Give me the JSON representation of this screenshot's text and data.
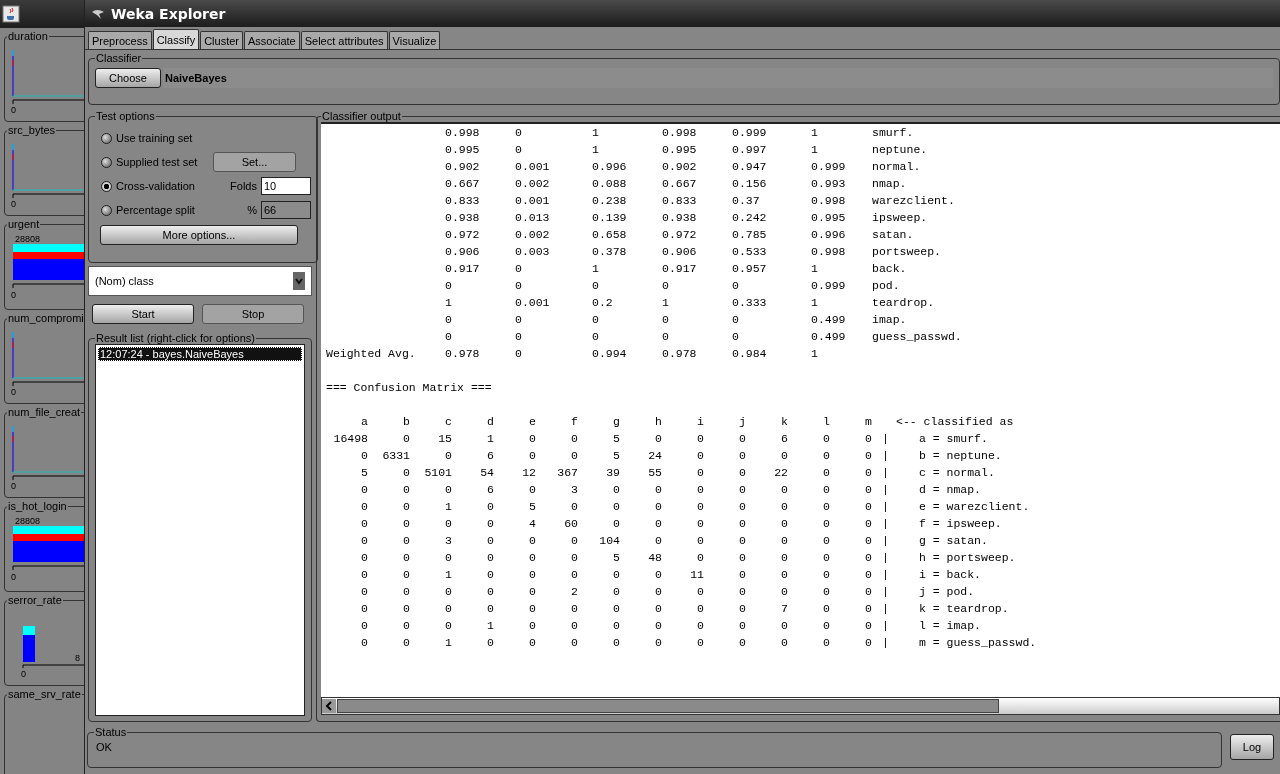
{
  "window": {
    "title": "Weka Explorer"
  },
  "attribute_panels": [
    {
      "name": "duration",
      "kind": "spike",
      "axis_label": "0"
    },
    {
      "name": "src_bytes",
      "kind": "spike",
      "axis_label": "0"
    },
    {
      "name": "urgent",
      "kind": "stacked",
      "count_label": "28808",
      "axis_label": "0"
    },
    {
      "name": "num_compromi",
      "kind": "spike",
      "axis_label": "0"
    },
    {
      "name": "num_file_creat",
      "kind": "spike",
      "axis_label": "0"
    },
    {
      "name": "is_hot_login",
      "kind": "stacked",
      "count_label": "28808",
      "axis_label": "0"
    },
    {
      "name": "serror_rate",
      "kind": "column",
      "count_label": "8",
      "axis_label": "0"
    },
    {
      "name": "same_srv_rate",
      "kind": "empty"
    }
  ],
  "tabs": [
    {
      "label": "Preprocess",
      "selected": false
    },
    {
      "label": "Classify",
      "selected": true
    },
    {
      "label": "Cluster",
      "selected": false
    },
    {
      "label": "Associate",
      "selected": false
    },
    {
      "label": "Select attributes",
      "selected": false
    },
    {
      "label": "Visualize",
      "selected": false
    }
  ],
  "classifier": {
    "title": "Classifier",
    "button": "Choose",
    "name": "NaiveBayes"
  },
  "test_options": {
    "title": "Test options",
    "options": [
      {
        "label": "Use training set",
        "selected": false
      },
      {
        "label": "Supplied test set",
        "selected": false
      },
      {
        "label": "Cross-validation",
        "selected": true
      },
      {
        "label": "Percentage split",
        "selected": false
      }
    ],
    "set_button": {
      "label": "Set...",
      "disabled": true
    },
    "folds": {
      "label": "Folds",
      "value": "10",
      "disabled": false
    },
    "percent": {
      "label": "%",
      "value": "66",
      "disabled": true
    },
    "more_button": "More options..."
  },
  "class_selector": {
    "value": "(Nom) class"
  },
  "start_button": {
    "label": "Start",
    "disabled": false
  },
  "stop_button": {
    "label": "Stop",
    "disabled": true
  },
  "result_list": {
    "title": "Result list (right-click for options)",
    "items": [
      {
        "label": "12:07:24 - bayes.NaiveBayes",
        "selected": true
      }
    ]
  },
  "output": {
    "title": "Classifier output",
    "accuracy_rows": [
      {
        "cells": [
          "0.998",
          "0",
          "1",
          "0.998",
          "0.999",
          "1",
          "smurf."
        ]
      },
      {
        "cells": [
          "0.995",
          "0",
          "1",
          "0.995",
          "0.997",
          "1",
          "neptune."
        ]
      },
      {
        "cells": [
          "0.902",
          "0.001",
          "0.996",
          "0.902",
          "0.947",
          "0.999",
          "normal."
        ]
      },
      {
        "cells": [
          "0.667",
          "0.002",
          "0.088",
          "0.667",
          "0.156",
          "0.993",
          "nmap."
        ]
      },
      {
        "cells": [
          "0.833",
          "0.001",
          "0.238",
          "0.833",
          "0.37",
          "0.998",
          "warezclient."
        ]
      },
      {
        "cells": [
          "0.938",
          "0.013",
          "0.139",
          "0.938",
          "0.242",
          "0.995",
          "ipsweep."
        ]
      },
      {
        "cells": [
          "0.972",
          "0.002",
          "0.658",
          "0.972",
          "0.785",
          "0.996",
          "satan."
        ]
      },
      {
        "cells": [
          "0.906",
          "0.003",
          "0.378",
          "0.906",
          "0.533",
          "0.998",
          "portsweep."
        ]
      },
      {
        "cells": [
          "0.917",
          "0",
          "1",
          "0.917",
          "0.957",
          "1",
          "back."
        ]
      },
      {
        "cells": [
          "0",
          "0",
          "0",
          "0",
          "0",
          "0.999",
          "pod."
        ]
      },
      {
        "cells": [
          "1",
          "0.001",
          "0.2",
          "1",
          "0.333",
          "1",
          "teardrop."
        ]
      },
      {
        "cells": [
          "0",
          "0",
          "0",
          "0",
          "0",
          "0.499",
          "imap."
        ]
      },
      {
        "cells": [
          "0",
          "0",
          "0",
          "0",
          "0",
          "0.499",
          "guess_passwd."
        ]
      },
      {
        "label": "Weighted Avg.",
        "cells": [
          "0.978",
          "0",
          "0.994",
          "0.978",
          "0.984",
          "1"
        ]
      }
    ],
    "matrix_title": "=== Confusion Matrix ===",
    "matrix_columns": [
      "a",
      "b",
      "c",
      "d",
      "e",
      "f",
      "g",
      "h",
      "i",
      "j",
      "k",
      "l",
      "m"
    ],
    "matrix_note": "<-- classified as",
    "matrix_rows": [
      {
        "counts": [
          "16498",
          "0",
          "15",
          "1",
          "0",
          "0",
          "5",
          "0",
          "0",
          "0",
          "6",
          "0",
          "0"
        ],
        "sep": "|",
        "label": "a = smurf."
      },
      {
        "counts": [
          "0",
          "6331",
          "0",
          "6",
          "0",
          "0",
          "5",
          "24",
          "0",
          "0",
          "0",
          "0",
          "0"
        ],
        "sep": "|",
        "label": "b = neptune."
      },
      {
        "counts": [
          "5",
          "0",
          "5101",
          "54",
          "12",
          "367",
          "39",
          "55",
          "0",
          "0",
          "22",
          "0",
          "0"
        ],
        "sep": "|",
        "label": "c = normal."
      },
      {
        "counts": [
          "0",
          "0",
          "0",
          "6",
          "0",
          "3",
          "0",
          "0",
          "0",
          "0",
          "0",
          "0",
          "0"
        ],
        "sep": "|",
        "label": "d = nmap."
      },
      {
        "counts": [
          "0",
          "0",
          "1",
          "0",
          "5",
          "0",
          "0",
          "0",
          "0",
          "0",
          "0",
          "0",
          "0"
        ],
        "sep": "|",
        "label": "e = warezclient."
      },
      {
        "counts": [
          "0",
          "0",
          "0",
          "0",
          "4",
          "60",
          "0",
          "0",
          "0",
          "0",
          "0",
          "0",
          "0"
        ],
        "sep": "|",
        "label": "f = ipsweep."
      },
      {
        "counts": [
          "0",
          "0",
          "3",
          "0",
          "0",
          "0",
          "104",
          "0",
          "0",
          "0",
          "0",
          "0",
          "0"
        ],
        "sep": "|",
        "label": "g = satan."
      },
      {
        "counts": [
          "0",
          "0",
          "0",
          "0",
          "0",
          "0",
          "5",
          "48",
          "0",
          "0",
          "0",
          "0",
          "0"
        ],
        "sep": "|",
        "label": "h = portsweep."
      },
      {
        "counts": [
          "0",
          "0",
          "1",
          "0",
          "0",
          "0",
          "0",
          "0",
          "11",
          "0",
          "0",
          "0",
          "0"
        ],
        "sep": "|",
        "label": "i = back."
      },
      {
        "counts": [
          "0",
          "0",
          "0",
          "0",
          "0",
          "2",
          "0",
          "0",
          "0",
          "0",
          "0",
          "0",
          "0"
        ],
        "sep": "|",
        "label": "j = pod."
      },
      {
        "counts": [
          "0",
          "0",
          "0",
          "0",
          "0",
          "0",
          "0",
          "0",
          "0",
          "0",
          "7",
          "0",
          "0"
        ],
        "sep": "|",
        "label": "k = teardrop."
      },
      {
        "counts": [
          "0",
          "0",
          "0",
          "1",
          "0",
          "0",
          "0",
          "0",
          "0",
          "0",
          "0",
          "0",
          "0"
        ],
        "sep": "|",
        "label": "l = imap."
      },
      {
        "counts": [
          "0",
          "0",
          "1",
          "0",
          "0",
          "0",
          "0",
          "0",
          "0",
          "0",
          "0",
          "0",
          "0"
        ],
        "sep": "|",
        "label": "m = guess_passwd."
      }
    ]
  },
  "status": {
    "title": "Status",
    "text": "OK",
    "log_button": "Log"
  }
}
